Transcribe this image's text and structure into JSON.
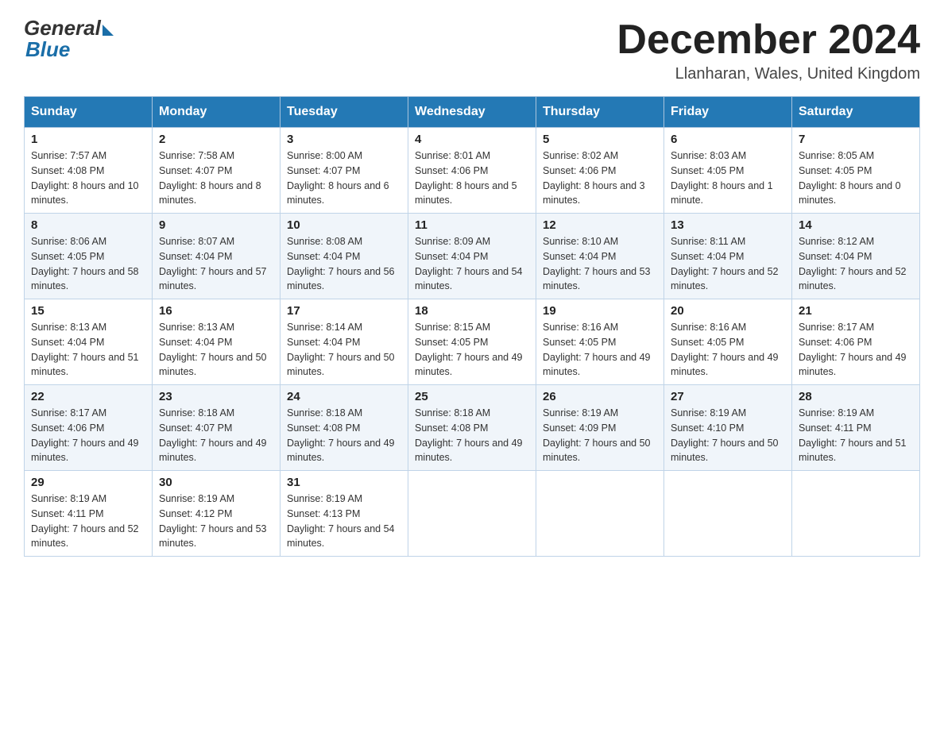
{
  "header": {
    "logo_general": "General",
    "logo_blue": "Blue",
    "month_title": "December 2024",
    "location": "Llanharan, Wales, United Kingdom"
  },
  "days_of_week": [
    "Sunday",
    "Monday",
    "Tuesday",
    "Wednesday",
    "Thursday",
    "Friday",
    "Saturday"
  ],
  "weeks": [
    [
      {
        "day": "1",
        "sunrise": "7:57 AM",
        "sunset": "4:08 PM",
        "daylight": "8 hours and 10 minutes."
      },
      {
        "day": "2",
        "sunrise": "7:58 AM",
        "sunset": "4:07 PM",
        "daylight": "8 hours and 8 minutes."
      },
      {
        "day": "3",
        "sunrise": "8:00 AM",
        "sunset": "4:07 PM",
        "daylight": "8 hours and 6 minutes."
      },
      {
        "day": "4",
        "sunrise": "8:01 AM",
        "sunset": "4:06 PM",
        "daylight": "8 hours and 5 minutes."
      },
      {
        "day": "5",
        "sunrise": "8:02 AM",
        "sunset": "4:06 PM",
        "daylight": "8 hours and 3 minutes."
      },
      {
        "day": "6",
        "sunrise": "8:03 AM",
        "sunset": "4:05 PM",
        "daylight": "8 hours and 1 minute."
      },
      {
        "day": "7",
        "sunrise": "8:05 AM",
        "sunset": "4:05 PM",
        "daylight": "8 hours and 0 minutes."
      }
    ],
    [
      {
        "day": "8",
        "sunrise": "8:06 AM",
        "sunset": "4:05 PM",
        "daylight": "7 hours and 58 minutes."
      },
      {
        "day": "9",
        "sunrise": "8:07 AM",
        "sunset": "4:04 PM",
        "daylight": "7 hours and 57 minutes."
      },
      {
        "day": "10",
        "sunrise": "8:08 AM",
        "sunset": "4:04 PM",
        "daylight": "7 hours and 56 minutes."
      },
      {
        "day": "11",
        "sunrise": "8:09 AM",
        "sunset": "4:04 PM",
        "daylight": "7 hours and 54 minutes."
      },
      {
        "day": "12",
        "sunrise": "8:10 AM",
        "sunset": "4:04 PM",
        "daylight": "7 hours and 53 minutes."
      },
      {
        "day": "13",
        "sunrise": "8:11 AM",
        "sunset": "4:04 PM",
        "daylight": "7 hours and 52 minutes."
      },
      {
        "day": "14",
        "sunrise": "8:12 AM",
        "sunset": "4:04 PM",
        "daylight": "7 hours and 52 minutes."
      }
    ],
    [
      {
        "day": "15",
        "sunrise": "8:13 AM",
        "sunset": "4:04 PM",
        "daylight": "7 hours and 51 minutes."
      },
      {
        "day": "16",
        "sunrise": "8:13 AM",
        "sunset": "4:04 PM",
        "daylight": "7 hours and 50 minutes."
      },
      {
        "day": "17",
        "sunrise": "8:14 AM",
        "sunset": "4:04 PM",
        "daylight": "7 hours and 50 minutes."
      },
      {
        "day": "18",
        "sunrise": "8:15 AM",
        "sunset": "4:05 PM",
        "daylight": "7 hours and 49 minutes."
      },
      {
        "day": "19",
        "sunrise": "8:16 AM",
        "sunset": "4:05 PM",
        "daylight": "7 hours and 49 minutes."
      },
      {
        "day": "20",
        "sunrise": "8:16 AM",
        "sunset": "4:05 PM",
        "daylight": "7 hours and 49 minutes."
      },
      {
        "day": "21",
        "sunrise": "8:17 AM",
        "sunset": "4:06 PM",
        "daylight": "7 hours and 49 minutes."
      }
    ],
    [
      {
        "day": "22",
        "sunrise": "8:17 AM",
        "sunset": "4:06 PM",
        "daylight": "7 hours and 49 minutes."
      },
      {
        "day": "23",
        "sunrise": "8:18 AM",
        "sunset": "4:07 PM",
        "daylight": "7 hours and 49 minutes."
      },
      {
        "day": "24",
        "sunrise": "8:18 AM",
        "sunset": "4:08 PM",
        "daylight": "7 hours and 49 minutes."
      },
      {
        "day": "25",
        "sunrise": "8:18 AM",
        "sunset": "4:08 PM",
        "daylight": "7 hours and 49 minutes."
      },
      {
        "day": "26",
        "sunrise": "8:19 AM",
        "sunset": "4:09 PM",
        "daylight": "7 hours and 50 minutes."
      },
      {
        "day": "27",
        "sunrise": "8:19 AM",
        "sunset": "4:10 PM",
        "daylight": "7 hours and 50 minutes."
      },
      {
        "day": "28",
        "sunrise": "8:19 AM",
        "sunset": "4:11 PM",
        "daylight": "7 hours and 51 minutes."
      }
    ],
    [
      {
        "day": "29",
        "sunrise": "8:19 AM",
        "sunset": "4:11 PM",
        "daylight": "7 hours and 52 minutes."
      },
      {
        "day": "30",
        "sunrise": "8:19 AM",
        "sunset": "4:12 PM",
        "daylight": "7 hours and 53 minutes."
      },
      {
        "day": "31",
        "sunrise": "8:19 AM",
        "sunset": "4:13 PM",
        "daylight": "7 hours and 54 minutes."
      },
      null,
      null,
      null,
      null
    ]
  ]
}
